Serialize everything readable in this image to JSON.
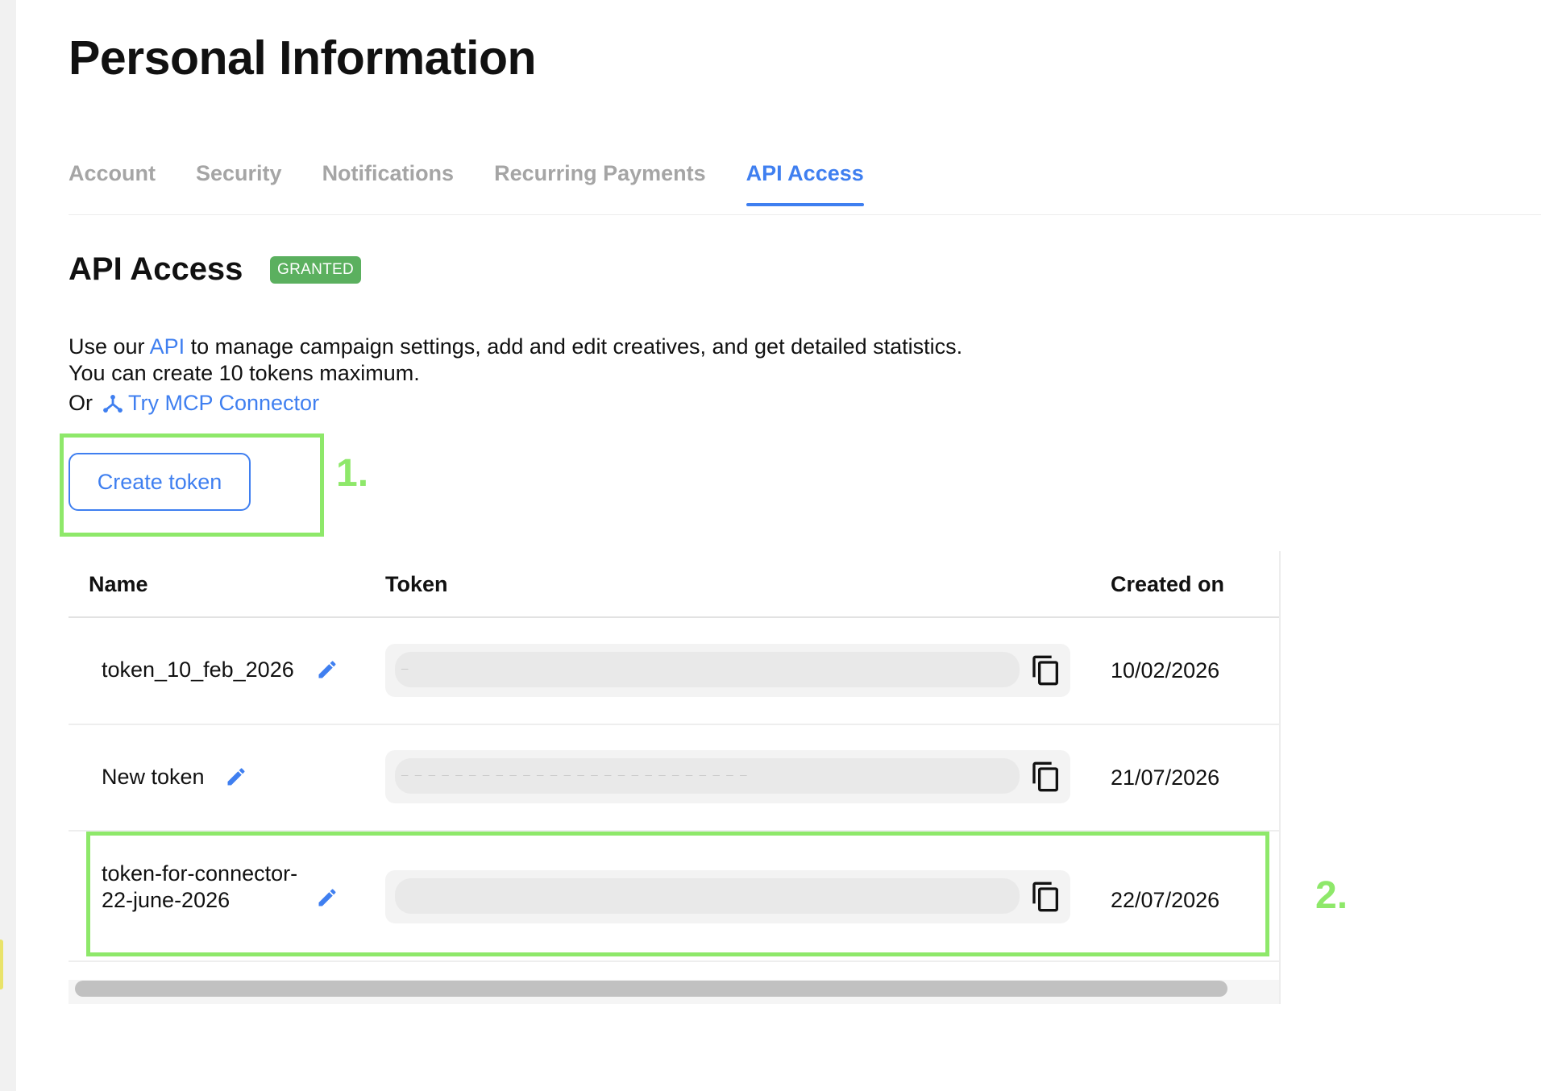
{
  "page": {
    "title": "Personal Information"
  },
  "tabs": [
    {
      "label": "Account"
    },
    {
      "label": "Security"
    },
    {
      "label": "Notifications"
    },
    {
      "label": "Recurring Payments"
    },
    {
      "label": "API Access"
    }
  ],
  "section": {
    "title": "API Access",
    "badge": "GRANTED",
    "desc_pre": "Use our ",
    "desc_link": "API",
    "desc_post": " to manage campaign settings, add and edit creatives, and get detailed statistics.",
    "limit_text": "You can create 10 tokens maximum.",
    "or_text": "Or",
    "mcp_link": "Try MCP Connector"
  },
  "create_button": {
    "label": "Create token"
  },
  "annotations": {
    "one": "1.",
    "two": "2."
  },
  "table": {
    "headers": {
      "name": "Name",
      "token": "Token",
      "created": "Created on"
    },
    "rows": [
      {
        "name": "token_10_feb_2026",
        "token": "—",
        "created": "10/02/2026"
      },
      {
        "name": "New token",
        "token": "— — — — — — — — — — — — — — — — — — — — — — — — — —",
        "created": "21/07/2026"
      },
      {
        "name": "token-for-connector-22-june-2026",
        "token": "",
        "created": "22/07/2026"
      }
    ]
  },
  "colors": {
    "accent": "#3f7ff0",
    "badge": "#5bb05f",
    "highlight": "#8ee86a"
  },
  "icons": {
    "edit": "pencil-icon",
    "copy": "copy-icon",
    "mcp": "connector-icon"
  }
}
